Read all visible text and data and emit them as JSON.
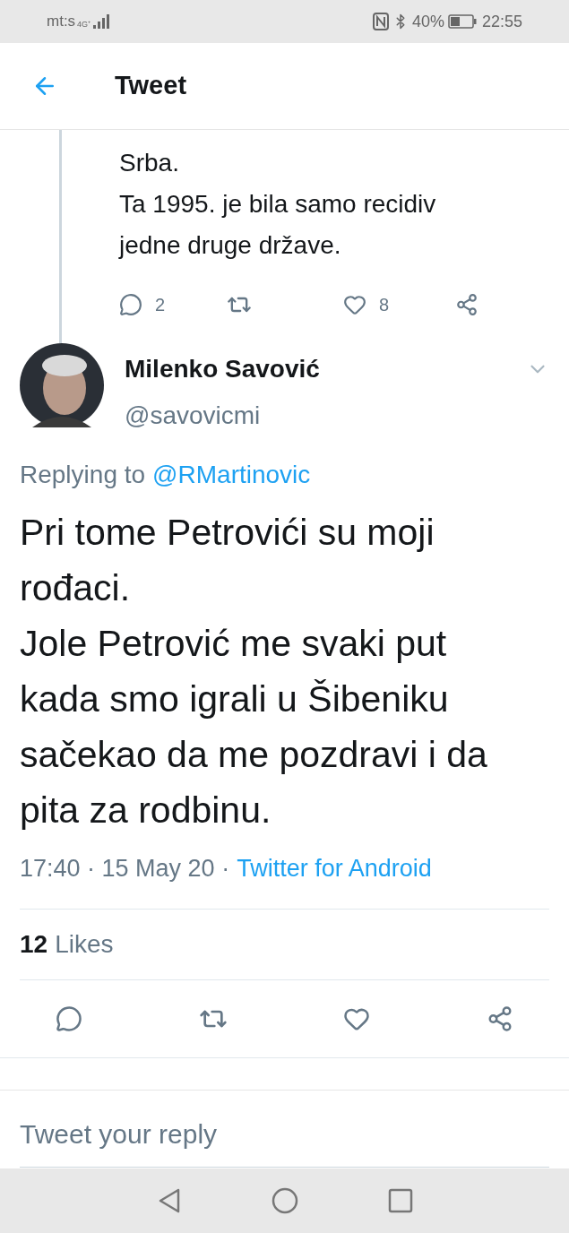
{
  "status_bar": {
    "carrier": "mt:s",
    "network": "4G⁺",
    "battery": "40%",
    "time": "22:55"
  },
  "header": {
    "title": "Tweet"
  },
  "previous_tweet": {
    "text": "Srba.\nTa 1995. je bila samo recidiv\njedne druge države.",
    "replies": "2",
    "likes": "8"
  },
  "tweet": {
    "name": "Milenko Savović",
    "handle": "@savovicmi",
    "replying_label": "Replying to",
    "replying_to": "@RMartinovic",
    "text": "Pri tome Petrovići su moji rođaci.\nJole Petrović me svaki put kada smo igrali u Šibeniku sačekao da me pozdravi i da pita za rodbinu.",
    "time": "17:40 · 15 May 20 ·",
    "source": "Twitter for Android",
    "likes_count": "12",
    "likes_label": "Likes"
  },
  "reply_field": {
    "placeholder": "Tweet your reply"
  }
}
